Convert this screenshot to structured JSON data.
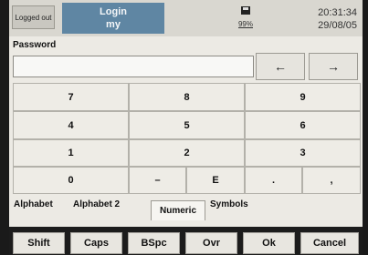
{
  "header": {
    "logged_out": "Logged out",
    "login_title": "Login",
    "login_user": "my",
    "disk_percent": "99%",
    "time": "20:31:34",
    "date": "29/08/05"
  },
  "password": {
    "label": "Password",
    "value": "",
    "left_arrow": "←",
    "right_arrow": "→"
  },
  "keypad": {
    "row1": [
      "7",
      "8",
      "9"
    ],
    "row2": [
      "4",
      "5",
      "6"
    ],
    "row3": [
      "1",
      "2",
      "3"
    ],
    "row4": [
      "0",
      "–",
      "E",
      ".",
      ","
    ]
  },
  "tabs": {
    "alphabet": "Alphabet",
    "alphabet2": "Alphabet 2",
    "numeric": "Numeric",
    "symbols": "Symbols",
    "active": "Numeric"
  },
  "bottom": {
    "shift": "Shift",
    "caps": "Caps",
    "bspc": "BSpc",
    "ovr": "Ovr",
    "ok": "Ok",
    "cancel": "Cancel"
  },
  "colors": {
    "login_bg": "#5f86a3",
    "screen_bg": "#eceae4",
    "bezel": "#1a1a1a"
  },
  "icons": {
    "disk": "floppy-disk-icon"
  }
}
